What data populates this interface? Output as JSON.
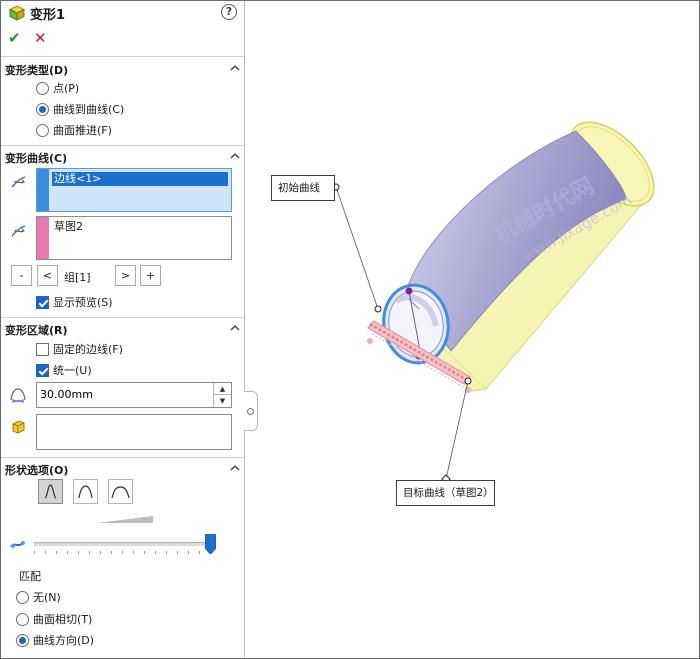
{
  "feature": {
    "title": "变形1",
    "help_label": "?"
  },
  "actions": {
    "ok_label": "✔",
    "cancel_label": "✕"
  },
  "sections": {
    "deform_type": {
      "header": "变形类型(D)",
      "options": [
        {
          "label": "点(P)",
          "selected": false
        },
        {
          "label": "曲线到曲线(C)",
          "selected": true
        },
        {
          "label": "曲面推进(F)",
          "selected": false
        }
      ]
    },
    "deform_curves": {
      "header": "变形曲线(C)",
      "initial_curves": [
        "边线<1>"
      ],
      "target_curves": [
        "草图2"
      ],
      "buttons": {
        "minus": "-",
        "prev": "<",
        "group_label": "组[1]",
        "next": ">",
        "plus": "+"
      },
      "show_preview": {
        "label": "显示预览(S)",
        "checked": true
      },
      "colors": {
        "initial": "#3d8ee0",
        "target": "#e879b0"
      }
    },
    "deform_region": {
      "header": "变形区域(R)",
      "fixed_edges": {
        "label": "固定的边线(F)",
        "checked": false
      },
      "uniform": {
        "label": "统一(U)",
        "checked": true
      },
      "radius_value": "30.00mm"
    },
    "shape_options": {
      "header": "形状选项(O)",
      "stiffness_selected_index": 0,
      "slider_fraction": 1.0,
      "match_label": "匹配",
      "match_options": [
        {
          "label": "无(N)",
          "selected": false
        },
        {
          "label": "曲面相切(T)",
          "selected": false
        },
        {
          "label": "曲线方向(D)",
          "selected": true
        }
      ]
    }
  },
  "viewport": {
    "callout_initial": "初始曲线",
    "callout_target": "目标曲线（草图2）",
    "watermark_cn": "机械时代网",
    "watermark_en": "www.jixage.com"
  },
  "icons": {
    "title": "deform-feature-icon",
    "initial_curve": "initial-curve-icon",
    "target_curve": "target-curve-icon",
    "radius": "deform-radius-icon",
    "face": "face-selection-icon",
    "slider": "shape-accuracy-icon"
  }
}
